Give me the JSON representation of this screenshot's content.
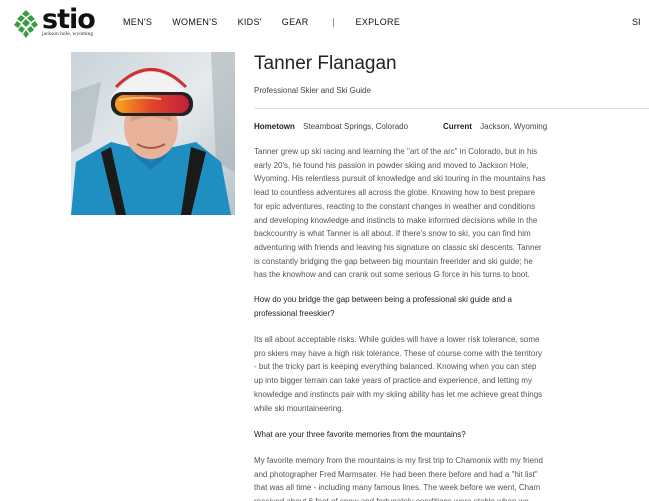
{
  "brand": {
    "name": "stio",
    "tagline": "jackson hole, wyoming",
    "color": "#3a9a45"
  },
  "nav": {
    "items": [
      "MEN'S",
      "WOMEN'S",
      "KIDS'",
      "GEAR",
      "EXPLORE"
    ],
    "right_partial": "SI"
  },
  "profile": {
    "name": "Tanner Flanagan",
    "title": "Professional Skier and Ski Guide",
    "hometown_label": "Hometown",
    "hometown_value": "Steamboat Springs, Colorado",
    "current_label": "Current",
    "current_value": "Jackson, Wyoming"
  },
  "bio": "Tanner grew up ski racing and learning the \"art of the arc\" in Colorado, but in his early 20's, he found his passion in powder skiing and moved to Jackson Hole, Wyoming. His relentless pursuit of knowledge and ski touring in the mountains has lead to countless adventures all across the globe. Knowing how to best prepare for epic adventures, reacting to the constant changes in weather and conditions and developing knowledge and instincts to make informed decisions while in the backcountry is what Tanner is all about. If there's snow to ski, you can find him adventuring with friends and leaving his signature on classic ski descents. Tanner is constantly bridging the gap between big mountain freerider and ski guide; he has the knowhow and can crank out some serious G force in his turns to boot.",
  "qa": [
    {
      "question": "How do you bridge the gap between being a professional ski guide and a professional freeskier?",
      "answer": "Its all about acceptable risks. While guides will have a lower risk tolerance, some pro skiers may have a high risk tolerance. These of course come with the territory - but the tricky part is keeping everything balanced. Knowing when you can step up into bigger terrain can take years of practice and experience, and letting my knowledge and instincts pair with my skiing ability has let me achieve great things while ski mountaineering."
    },
    {
      "question": "What are your three favorite memories from the mountains?",
      "answer": "My favorite memory from the mountains is my first trip to Chamonix with my friend and photographer Fred Marmsater. He had been there before and had a \"hit list\" that was all time - including many famous lines. The week before we went, Cham received about 6 feet of snow and fortunately conditions were stable when we"
    }
  ]
}
